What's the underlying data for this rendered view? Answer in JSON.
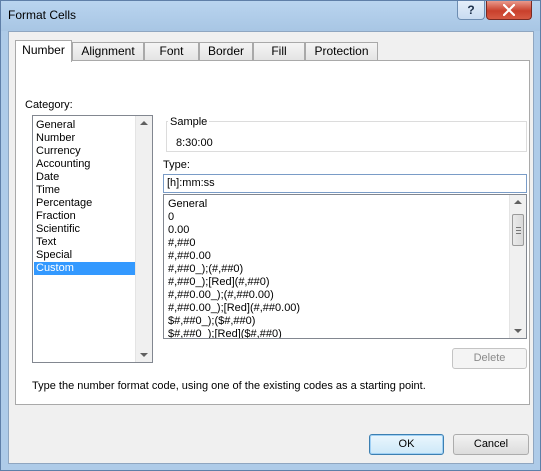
{
  "window": {
    "title": "Format Cells",
    "help_label": "?"
  },
  "tabs": [
    {
      "label": "Number"
    },
    {
      "label": "Alignment"
    },
    {
      "label": "Font"
    },
    {
      "label": "Border"
    },
    {
      "label": "Fill"
    },
    {
      "label": "Protection"
    }
  ],
  "active_tab": "Number",
  "category": {
    "label": "Category:",
    "items": [
      "General",
      "Number",
      "Currency",
      "Accounting",
      "Date",
      "Time",
      "Percentage",
      "Fraction",
      "Scientific",
      "Text",
      "Special",
      "Custom"
    ],
    "selected": "Custom"
  },
  "sample": {
    "label": "Sample",
    "value": "8:30:00"
  },
  "type": {
    "label": "Type:",
    "value": "[h]:mm:ss",
    "formats": [
      "General",
      "0",
      "0.00",
      "#,##0",
      "#,##0.00",
      "#,##0_);(#,##0)",
      "#,##0_);[Red](#,##0)",
      "#,##0.00_);(#,##0.00)",
      "#,##0.00_);[Red](#,##0.00)",
      "$#,##0_);($#,##0)",
      "$#,##0_);[Red]($#,##0)"
    ]
  },
  "buttons": {
    "delete": "Delete",
    "ok": "OK",
    "cancel": "Cancel"
  },
  "hint": "Type the number format code, using one of the existing codes as a starting point.",
  "colors": {
    "selection": "#3399ff",
    "close_button": "#c9402c",
    "title_bar": "#aecbe8"
  }
}
